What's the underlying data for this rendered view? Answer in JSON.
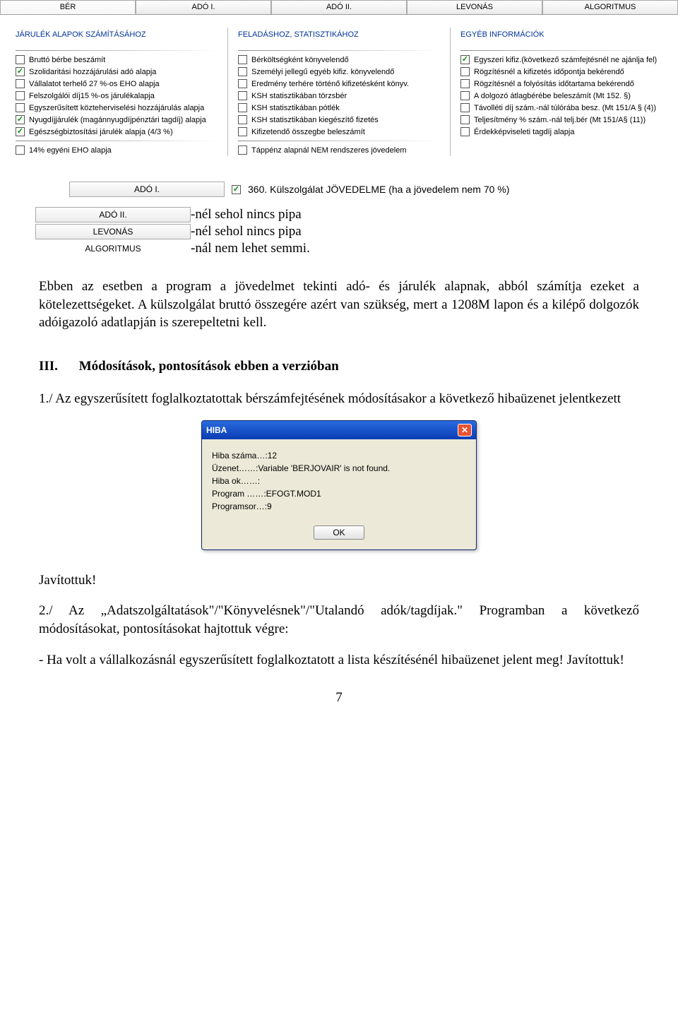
{
  "tabs": [
    "BÉR",
    "ADÓ I.",
    "ADÓ II.",
    "LEVONÁS",
    "ALGORITMUS"
  ],
  "panels": {
    "col1": {
      "title": "JÁRULÉK ALAPOK SZÁMÍTÁSÁHOZ",
      "items": [
        {
          "label": "Bruttó bérbe beszámít",
          "checked": false
        },
        {
          "label": "Szolidaritási hozzájárulási adó alapja",
          "checked": true
        },
        {
          "label": "Vállalatot terhelő 27 %-os EHO alapja",
          "checked": false
        },
        {
          "label": "Felszolgálói díj15 %-os járulékalapja",
          "checked": false
        },
        {
          "label": "Egyszerűsített közteherviselési hozzájárulás alapja",
          "checked": false
        },
        {
          "label": "Nyugdíjjárulék (magánnyugdíjpénztári tagdíj) alapja",
          "checked": true
        },
        {
          "label": "Egészségbiztosítási járulék alapja (4/3 %)",
          "checked": true
        },
        {
          "label": "14% egyéni EHO alapja",
          "checked": false
        }
      ]
    },
    "col2": {
      "title": "FELADÁSHOZ, STATISZTIKÁHOZ",
      "items": [
        {
          "label": "Bérköltségként könyvelendő",
          "checked": false
        },
        {
          "label": "Személyi jellegű egyéb kifiz. könyvelendő",
          "checked": false
        },
        {
          "label": "Eredmény terhére történő kifizetésként könyv.",
          "checked": false
        },
        {
          "label": "KSH statisztikában törzsbér",
          "checked": false
        },
        {
          "label": "KSH statisztikában pótlék",
          "checked": false
        },
        {
          "label": "KSH statisztikában kiegészítő fizetés",
          "checked": false
        },
        {
          "label": "Kifizetendő összegbe beleszámít",
          "checked": false
        },
        {
          "label": "Táppénz alapnál NEM rendszeres jövedelem",
          "checked": false
        }
      ]
    },
    "col3": {
      "title": "EGYÉB INFORMÁCIÓK",
      "items": [
        {
          "label": "Egyszeri kifiz.(következő számfejtésnél ne ajánlja fel)",
          "checked": true
        },
        {
          "label": "Rögzítésnél a kifizetés időpontja bekérendő",
          "checked": false
        },
        {
          "label": "Rögzítésnél a folyósítás időtartama bekérendő",
          "checked": false
        },
        {
          "label": "A dolgozó átlagbérébe beleszámít (Mt 152. §)",
          "checked": false
        },
        {
          "label": "Távolléti díj szám.-nál túlórába besz. (Mt 151/A § (4))",
          "checked": false
        },
        {
          "label": "Teljesítmény % szám.-nál telj.bér (Mt 151/A§ (11))",
          "checked": false
        },
        {
          "label": "Érdekképviseleti tagdíj alapja",
          "checked": false
        }
      ]
    }
  },
  "ado1_line": {
    "tab": "ADÓ I.",
    "text": "360. Külszolgálat JÖVEDELME (ha a jövedelem nem 70 %)"
  },
  "seg": {
    "rows": [
      {
        "label": "ADÓ II.",
        "style": "btn",
        "note": "-nél sehol nincs pipa"
      },
      {
        "label": "LEVONÁS",
        "style": "btn",
        "note": "-nél sehol nincs pipa"
      },
      {
        "label": "ALGORITMUS",
        "style": "plain",
        "note": "-nál nem lehet semmi."
      }
    ]
  },
  "body": {
    "p1": "Ebben az esetben a program a jövedelmet tekinti adó- és járulék alapnak, abból számítja ezeket a kötelezettségeket. A külszolgálat bruttó összegére azért van szükség, mert a 1208M lapon és a kilépő dolgozók adóigazoló adatlapján is szerepeltetni kell.",
    "h3_num": "III.",
    "h3_txt": "Módosítások, pontosítások ebben a verzióban",
    "p2": "1./ Az egyszerűsített foglalkoztatottak bérszámfejtésének módosításakor a következő hibaüzenet jelentkezett",
    "p3": "Javítottuk!",
    "p4": "2./ Az „Adatszolgáltatások\"/\"Könyvelésnek\"/\"Utalandó adók/tagdíjak.\" Programban a következő módosításokat, pontosításokat hajtottuk végre:",
    "p5": "- Ha volt a vállalkozásnál egyszerűsített foglalkoztatott a lista készítésénél hibaüzenet jelent meg! Javítottuk!"
  },
  "dialog": {
    "title": "HIBA",
    "body": "Hiba száma…:12\nÜzenet……:Variable 'BERJOVAIR' is not found.\nHiba ok……:\nProgram ……:EFOGT.MOD1\nProgramsor…:9",
    "ok": "OK"
  },
  "page": "7"
}
